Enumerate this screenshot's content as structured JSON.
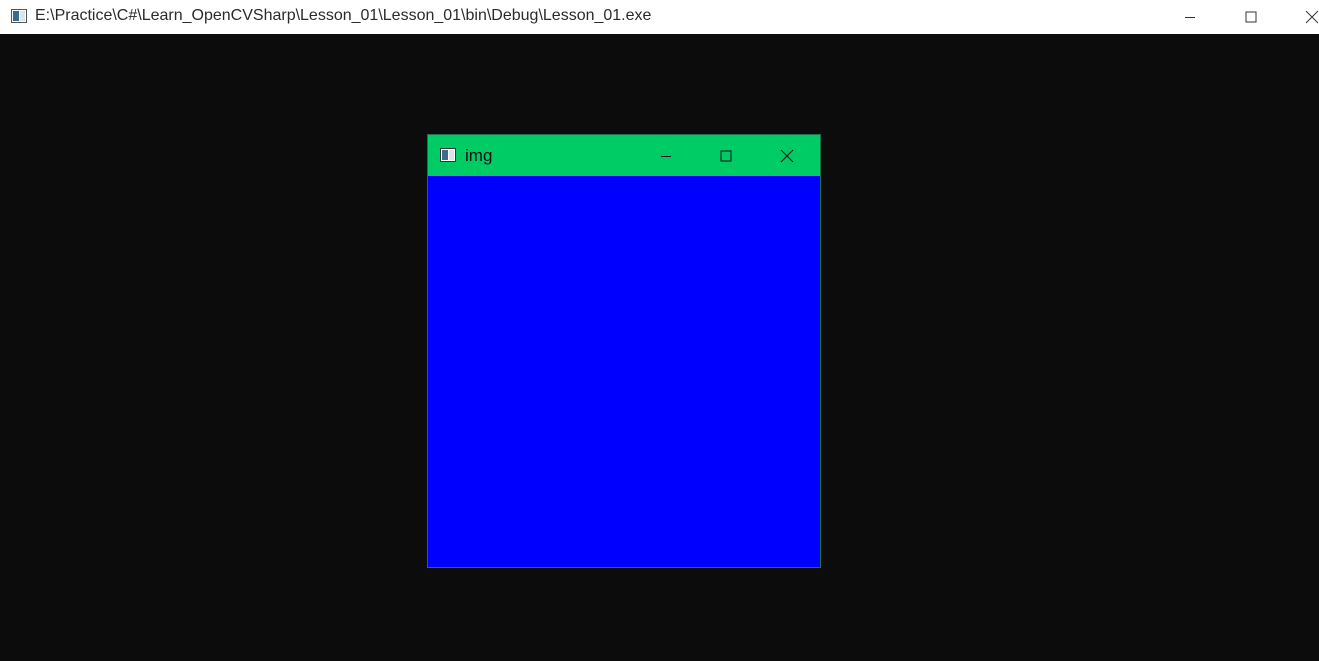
{
  "console_window": {
    "title": "E:\\Practice\\C#\\Learn_OpenCVSharp\\Lesson_01\\Lesson_01\\bin\\Debug\\Lesson_01.exe",
    "icon": "console-app-icon",
    "background_color": "#0c0c0c",
    "controls": [
      "minimize-icon",
      "maximize-icon",
      "close-icon"
    ]
  },
  "img_window": {
    "title": "img",
    "icon": "image-window-icon",
    "titlebar_color": "#00cc66",
    "canvas_color": "#0000ff",
    "controls": [
      "minimize-icon",
      "maximize-icon",
      "close-icon"
    ]
  }
}
